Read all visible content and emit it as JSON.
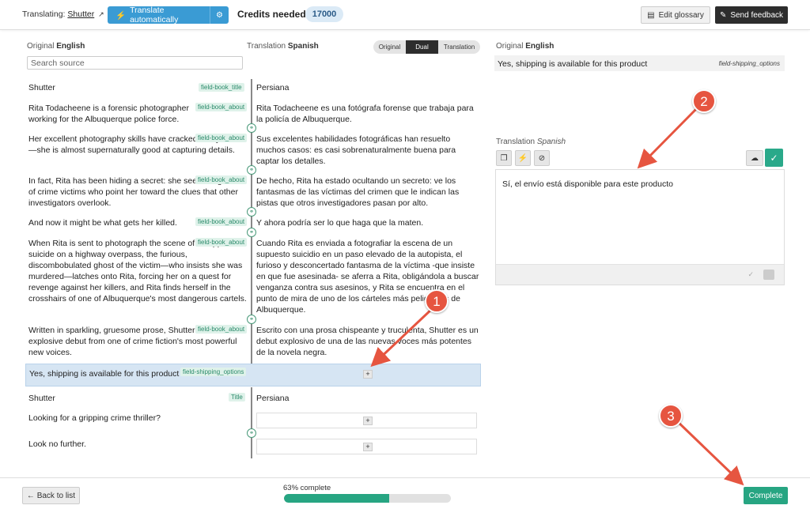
{
  "topbar": {
    "translating_label": "Translating:",
    "translating_link": "Shutter",
    "auto_button": "Translate automatically",
    "credits_label": "Credits needed",
    "credits_value": "17000",
    "glossary_button": "Edit glossary",
    "feedback_button": "Send feedback"
  },
  "left": {
    "original_label": "Original",
    "original_lang": "English",
    "translation_label": "Translation",
    "translation_lang": "Spanish",
    "search_placeholder": "Search source",
    "view_modes": [
      "Original",
      "Dual",
      "Translation"
    ],
    "active_view": "Dual"
  },
  "segments": [
    {
      "source": "Shutter",
      "tag": "field-book_title",
      "target": "Persiana"
    },
    {
      "source": "Rita Todacheene is a forensic photographer working for the Albuquerque police force.",
      "tag": "field-book_about",
      "target": "Rita Todacheene es una fotógrafa forense que trabaja para la policía de Albuquerque."
    },
    {
      "source": "Her excellent photography skills have cracked many cases—she is almost supernaturally good at capturing details.",
      "tag": "field-book_about",
      "target": "Sus excelentes habilidades fotográficas han resuelto muchos casos: es casi sobrenaturalmente buena para captar los detalles."
    },
    {
      "source": "In fact, Rita has been hiding a secret: she sees the ghosts of crime victims who point her toward the clues that other investigators overlook.",
      "tag": "field-book_about",
      "target": "De hecho, Rita ha estado ocultando un secreto: ve los fantasmas de las víctimas del crimen que le indican las pistas que otros investigadores pasan por alto."
    },
    {
      "source": "And now it might be what gets her killed.",
      "tag": "field-book_about",
      "target": "Y ahora podría ser lo que haga que la maten."
    },
    {
      "source": "When Rita is sent to photograph the scene of a supposed suicide on a highway overpass, the furious, discombobulated ghost of the victim—who insists she was murdered—latches onto Rita, forcing her on a quest for revenge against her killers, and Rita finds herself in the crosshairs of one of Albuquerque's most dangerous cartels.",
      "tag": "field-book_about",
      "target": "Cuando Rita es enviada a fotografiar la escena de un supuesto suicidio en un paso elevado de la autopista, el furioso y desconcertado fantasma de la víctima -que insiste en que fue asesinada- se aferra a Rita, obligándola a buscar venganza contra sus asesinos, y Rita se encuentra en el punto de mira de uno de los cárteles más peligrosos de Albuquerque."
    },
    {
      "source": "Written in sparkling, gruesome prose, Shutter is an explosive debut from one of crime fiction's most powerful new voices.",
      "tag": "field-book_about",
      "target": "Escrito con una prosa chispeante y truculenta, Shutter es un debut explosivo de una de las nuevas voces más potentes de la novela negra."
    },
    {
      "source": "Yes, shipping is available for this product",
      "tag": "field-shipping_options",
      "target": ""
    },
    {
      "source": "Shutter",
      "tag": "Title",
      "target": "Persiana"
    },
    {
      "source": "Looking for a gripping crime thriller?",
      "tag": "",
      "target": ""
    },
    {
      "source": "Look no further.",
      "tag": "",
      "target": ""
    }
  ],
  "add_symbol": "+",
  "right": {
    "original_label": "Original",
    "original_lang": "English",
    "original_text": "Yes, shipping is available for this product",
    "original_tag": "field-shipping_options",
    "translation_label": "Translation",
    "translation_lang": "Spanish",
    "translation_text": "Sí, el envío está disponible para este producto"
  },
  "bottombar": {
    "back_button": "← Back to list",
    "progress_label": "63% complete",
    "progress_percent": 63,
    "complete_button": "Complete"
  },
  "annotations": [
    "1",
    "2",
    "3"
  ],
  "colors": {
    "accent_blue": "#3a9bd4",
    "accent_green": "#27a582",
    "annotation_red": "#e65540"
  },
  "icons": [
    "external-link-icon",
    "lightning-icon",
    "gear-icon",
    "glossary-icon",
    "pen-icon",
    "link-icon",
    "copy-icon",
    "eye-slash-icon",
    "cloud-upload-icon",
    "check-icon",
    "spellcheck-icon",
    "keyboard-icon"
  ]
}
